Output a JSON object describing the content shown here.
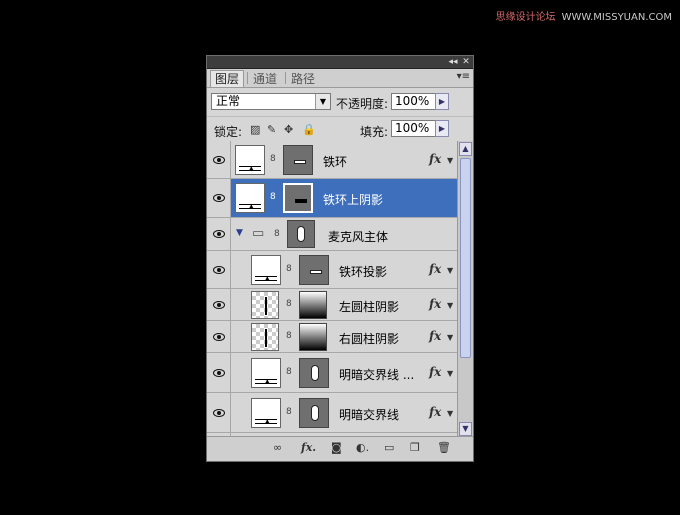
{
  "watermark": {
    "text": "思缘设计论坛",
    "site": "WWW.MISSYUAN.COM"
  },
  "titlebar": {
    "collapse_glyph": "◂◂",
    "close_glyph": "✕"
  },
  "tabs": [
    {
      "label": "图层",
      "active": true
    },
    {
      "label": "通道",
      "active": false
    },
    {
      "label": "路径",
      "active": false
    }
  ],
  "panel_menu_glyph": "▾≡",
  "blend_mode": {
    "value": "正常",
    "arrow": "▼"
  },
  "opacity": {
    "label": "不透明度:",
    "value": "100%",
    "arrow": "▶"
  },
  "lock": {
    "label": "锁定:",
    "icons": [
      "▨",
      "✎",
      "✥",
      "🔒"
    ]
  },
  "fill": {
    "label": "填充:",
    "value": "100%",
    "arrow": "▶"
  },
  "layers": [
    {
      "name": "铁环",
      "fx": "fx",
      "selected": false
    },
    {
      "name": "铁环上阴影",
      "fx": "",
      "selected": true
    },
    {
      "name": "麦克风主体",
      "fx": "",
      "selected": false,
      "group": true,
      "expander": "▼"
    },
    {
      "name": "铁环投影",
      "fx": "fx",
      "selected": false
    },
    {
      "name": "左圆柱阴影",
      "fx": "fx",
      "selected": false
    },
    {
      "name": "右圆柱阴影",
      "fx": "fx",
      "selected": false
    },
    {
      "name": "明暗交界线 ...",
      "fx": "fx",
      "selected": false
    },
    {
      "name": "明暗交界线",
      "fx": "fx",
      "selected": false
    }
  ],
  "scroll": {
    "up": "▲",
    "down": "▼"
  },
  "bottom_icons": [
    "∞",
    "fx.",
    "◙",
    "◐.",
    "▭",
    "❐",
    "🗑"
  ],
  "glyphs": {
    "tri": "▲",
    "fx_arrow": "▼",
    "chain": "8",
    "folder": "▭"
  }
}
